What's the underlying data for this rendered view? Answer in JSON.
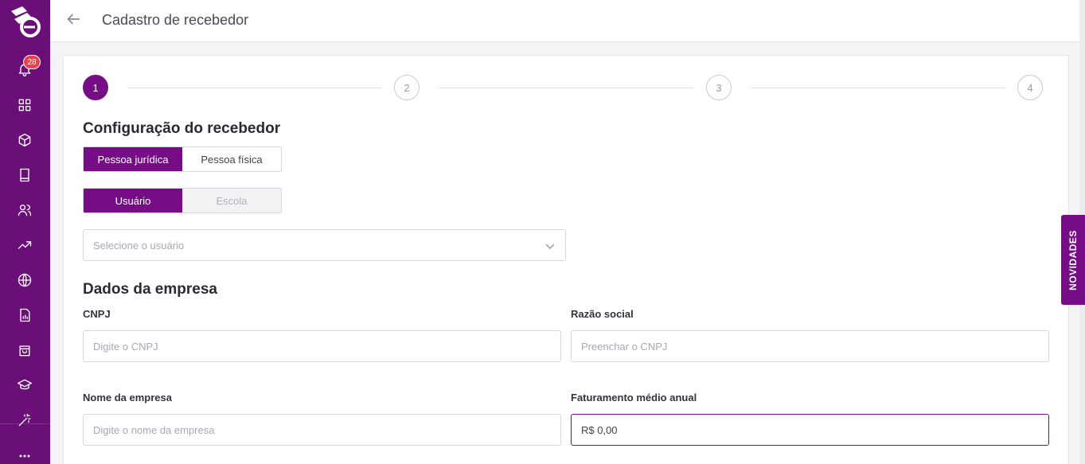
{
  "header": {
    "title": "Cadastro de recebedor"
  },
  "sidebar": {
    "notification_count": "28",
    "items": [
      {
        "icon": "bell-icon"
      },
      {
        "icon": "grid-icon"
      },
      {
        "icon": "box-icon"
      },
      {
        "icon": "book-icon"
      },
      {
        "icon": "users-icon"
      },
      {
        "icon": "trending-icon"
      },
      {
        "icon": "globe-icon"
      },
      {
        "icon": "report-icon"
      },
      {
        "icon": "shopping-bag-icon"
      },
      {
        "icon": "graduation-cap-icon"
      },
      {
        "icon": "magic-wand-icon"
      },
      {
        "icon": "more-icon"
      }
    ]
  },
  "stepper": {
    "steps": [
      "1",
      "2",
      "3",
      "4"
    ],
    "active": 1
  },
  "config": {
    "title": "Configuração do recebedor",
    "person_type": {
      "options": [
        "Pessoa jurídica",
        "Pessoa física"
      ],
      "selected": "Pessoa jurídica"
    },
    "target_type": {
      "options": [
        "Usuário",
        "Escola"
      ],
      "selected": "Usuário"
    },
    "user_select": {
      "placeholder": "Selecione o usuário"
    }
  },
  "company": {
    "title": "Dados da empresa",
    "cnpj": {
      "label": "CNPJ",
      "placeholder": "Digite o CNPJ"
    },
    "razao_social": {
      "label": "Razão social",
      "placeholder": "Preenchar o CNPJ"
    },
    "nome": {
      "label": "Nome da empresa",
      "placeholder": "Digite o nome da empresa"
    },
    "faturamento": {
      "label": "Faturamento médio anual",
      "value": "R$ 0,00"
    }
  },
  "novidades": {
    "label": "NOVIDADES"
  },
  "colors": {
    "primary": "#760c86",
    "sidebar": "#6a0f78",
    "badge": "#e8414b"
  }
}
